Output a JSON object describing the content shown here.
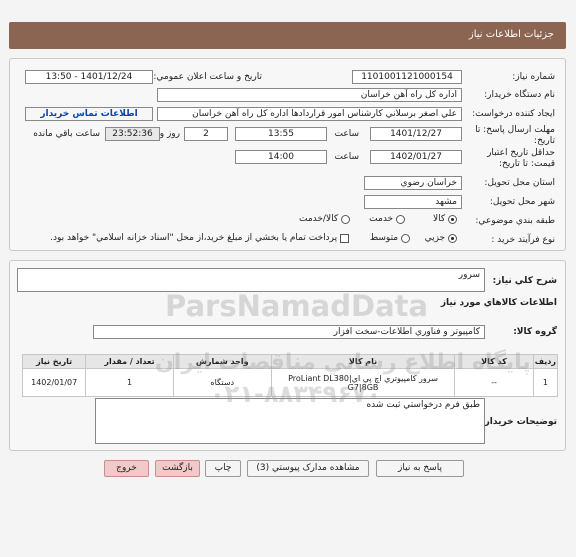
{
  "header": {
    "title": "جزئيات اطلاعات نياز"
  },
  "form": {
    "need_number_label": "شماره نياز:",
    "need_number": "1101001121000154",
    "announce_label": "تاريخ و ساعت اعلان عمومي:",
    "announce_value": "1401/12/24 - 13:50",
    "buyer_org_label": "نام دستگاه خريدار:",
    "buyer_org": "اداره كل راه آهن خراسان",
    "creator_label": "ايجاد كننده درخواست:",
    "creator": "علي اصغر برسلاني كارشناس امور قراردادها اداره كل راه آهن خراسان",
    "contact_link": "اطلاعات تماس خريدار",
    "deadline_label": "مهلت ارسال پاسخ: تا تاريخ:",
    "deadline_date": "1401/12/27",
    "time_label": "ساعت",
    "deadline_time": "13:55",
    "days_value": "2",
    "days_label": "روز و",
    "remaining_time": "23:52:36",
    "remaining_label": "ساعت باقي مانده",
    "validity_label": "حداقل تاريخ اعتبار قيمت: تا تاريخ:",
    "validity_date": "1402/01/27",
    "validity_time": "14:00",
    "province_label": "استان محل تحويل:",
    "province": "خراسان رضوي",
    "city_label": "شهر محل تحويل:",
    "city": "مشهد",
    "category_label": "طبقه بندي موضوعي:",
    "category_options": [
      "كالا",
      "خدمت",
      "كالا/خدمت"
    ],
    "category_selected": "كالا",
    "process_label": "نوع فرآيند خريد :",
    "process_options": [
      "جزيي",
      "متوسط"
    ],
    "process_selected": "جزيي",
    "payment_note": "پرداخت تمام يا بخشي از مبلغ خريد،از محل \"اسناد خزانه اسلامي\" خواهد بود."
  },
  "details": {
    "summary_label": "شرح كلي نياز:",
    "summary": "سرور",
    "goods_info_title": "اطلاعات كالاهاي مورد نياز",
    "group_label": "گروه كالا:",
    "group": "كامپيوتر و فناوري اطلاعات-سخت افزار",
    "table": {
      "headers": [
        "رديف",
        "كد كالا",
        "نام كالا",
        "واحد شمارش",
        "تعداد / مقدار",
        "تاريخ نياز"
      ],
      "rows": [
        [
          "1",
          "--",
          "سرور كامپيوتري اچ پي اي|ProLiant DL380 G7|8GB",
          "دستگاه",
          "1",
          "1402/01/07"
        ]
      ]
    },
    "buyer_notes_label": "توضيحات خريدار:",
    "buyer_notes": "طبق فرم درخواستي ثبت شده"
  },
  "buttons": {
    "reply": "پاسخ به نياز",
    "attachments": "مشاهده مدارک پيوستي (3)",
    "print": "چاپ",
    "back": "بازگشت",
    "exit": "خروج"
  },
  "watermark": {
    "brand": "ParsNamadData",
    "line1": "پايگاه اطلاع رساني مناقصات ايران",
    "phone": "۰۲۱-۸۸۳۴۹۶۷۰"
  }
}
